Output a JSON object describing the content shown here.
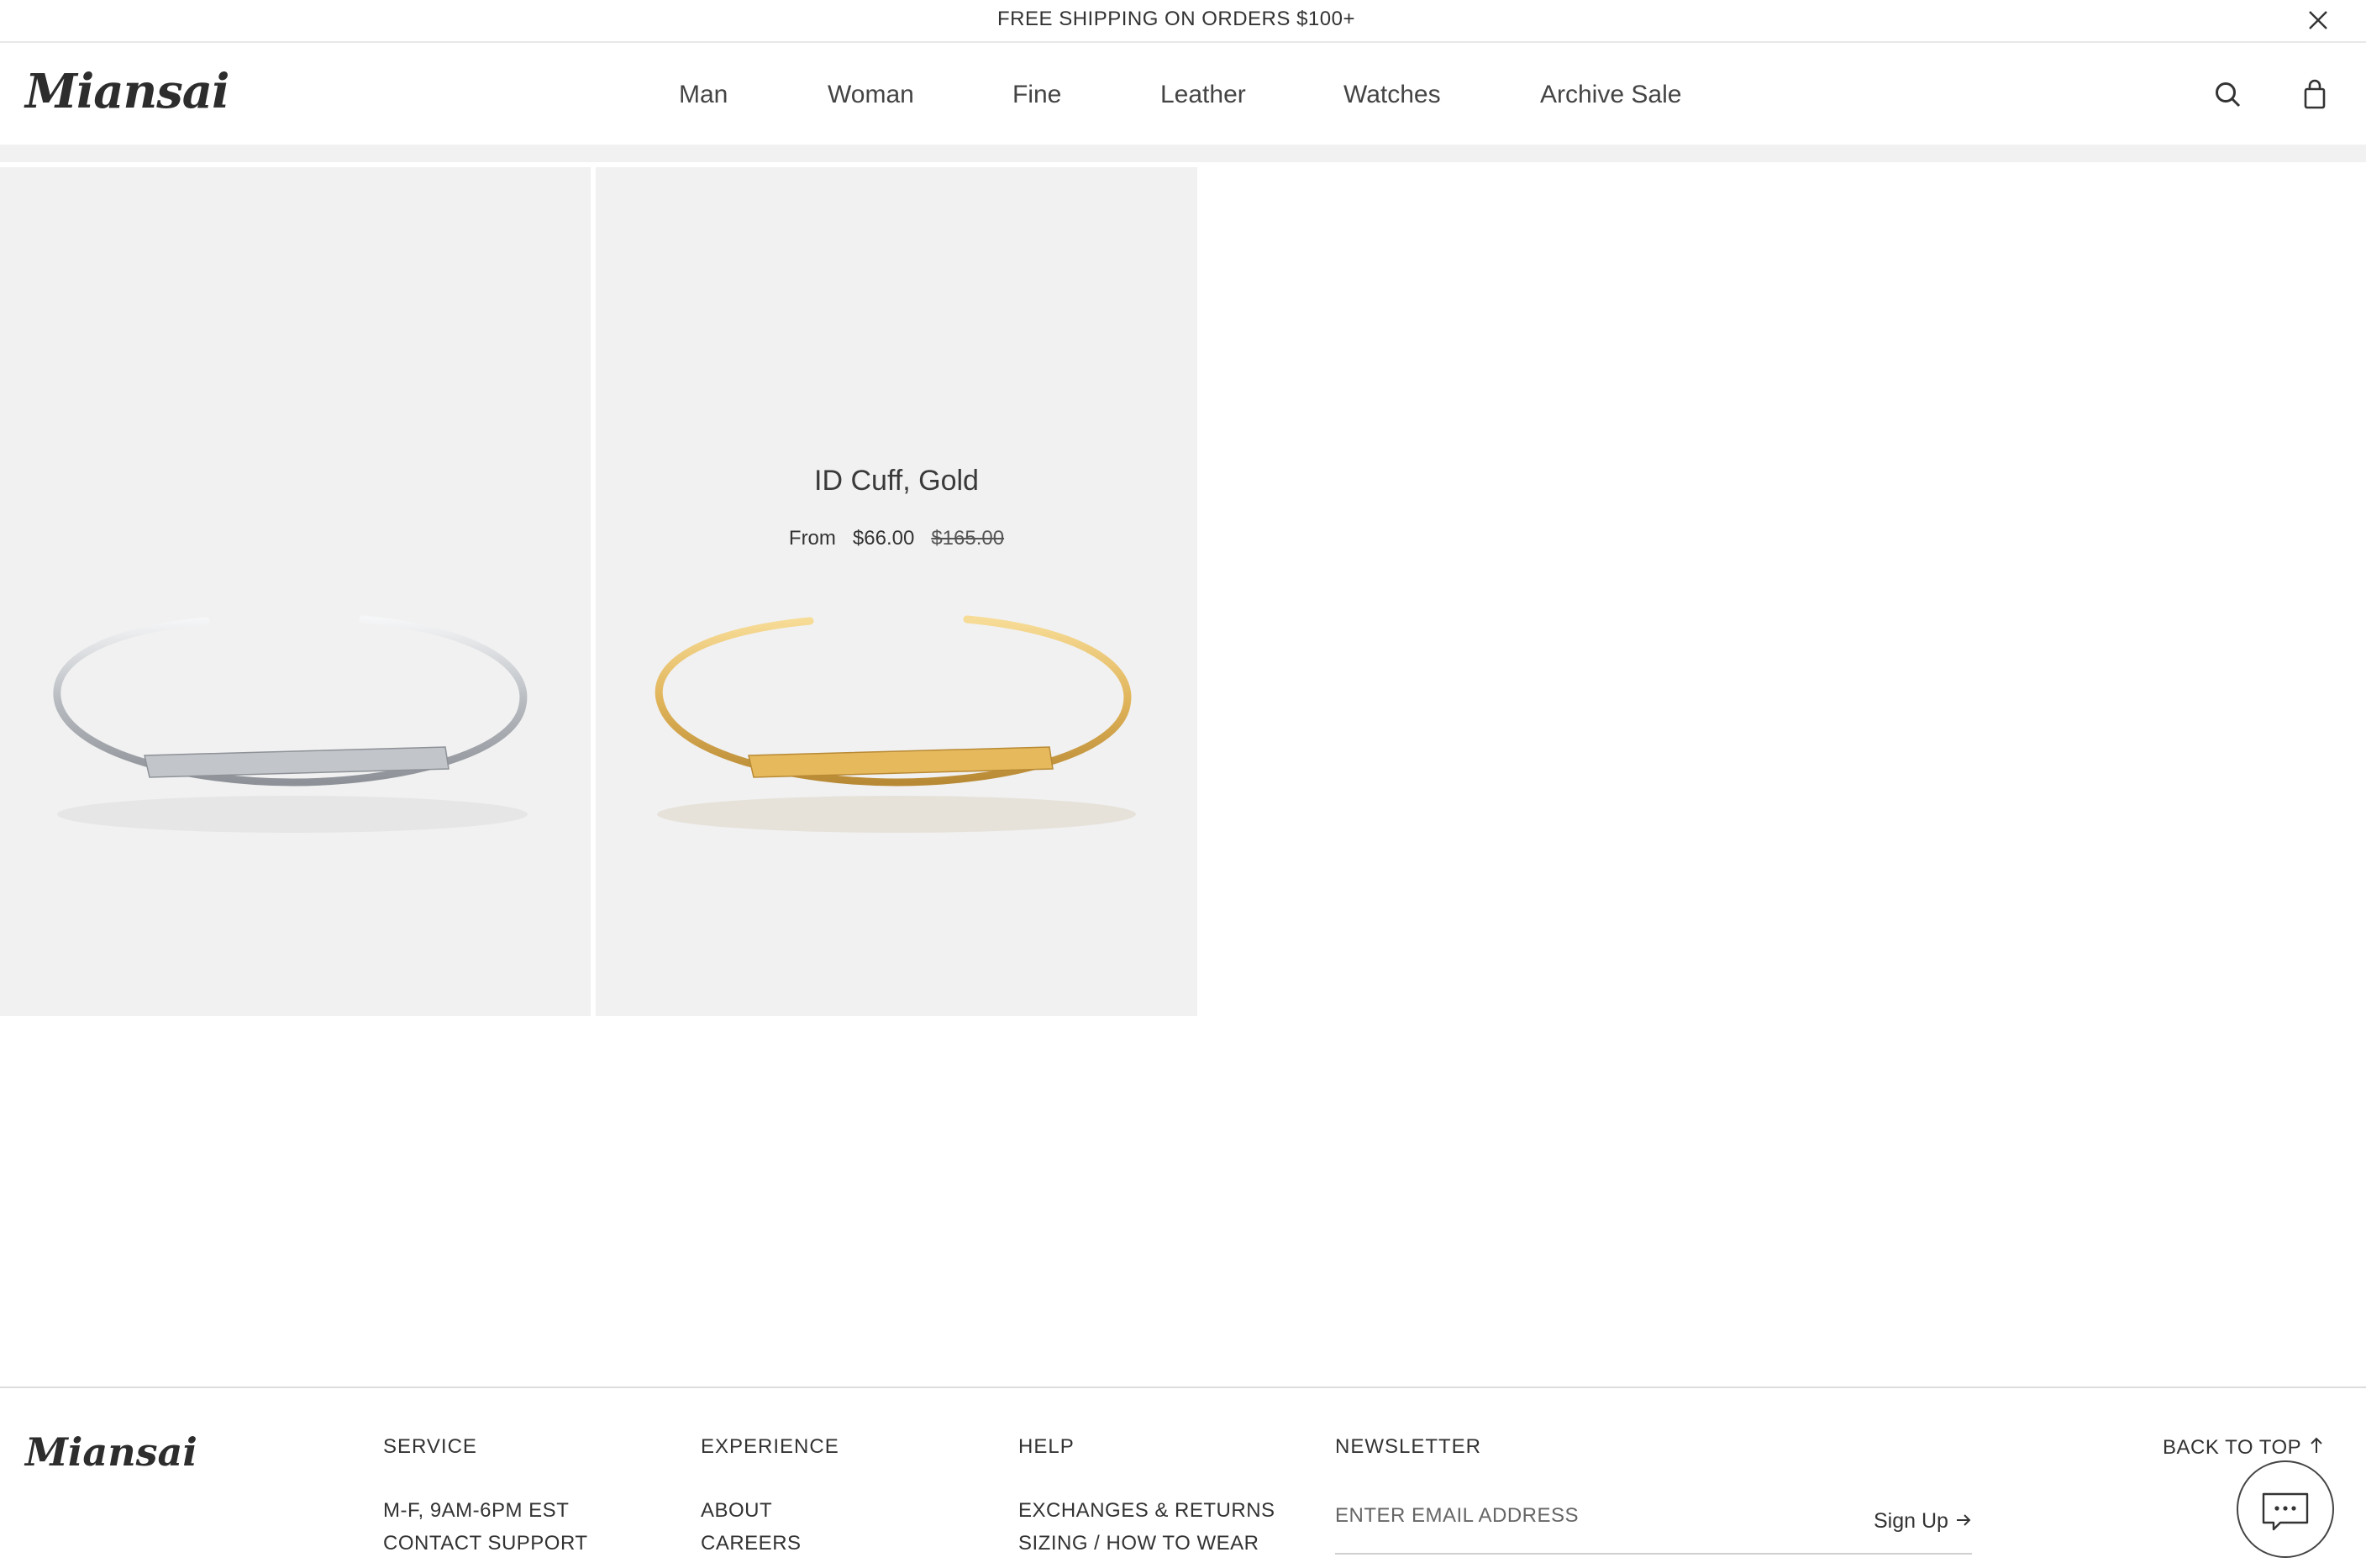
{
  "announcement": {
    "text": "FREE SHIPPING ON ORDERS $100+",
    "close_icon": "close-icon"
  },
  "header": {
    "logo": "Miansai",
    "nav": [
      {
        "label": "Man"
      },
      {
        "label": "Woman"
      },
      {
        "label": "Fine"
      },
      {
        "label": "Leather"
      },
      {
        "label": "Watches"
      },
      {
        "label": "Archive Sale"
      }
    ],
    "icons": [
      "search-icon",
      "shopping-bag-icon"
    ]
  },
  "products": [
    {
      "image": "silver-cuff-bracelet"
    },
    {
      "name": "ID Cuff, Gold",
      "price_prefix": "From",
      "price": "$66.00",
      "original_price": "$165.00",
      "image": "gold-cuff-bracelet"
    }
  ],
  "footer": {
    "logo": "Miansai",
    "columns": [
      {
        "heading": "SERVICE",
        "links": [
          "M-F, 9AM-6PM EST",
          "CONTACT SUPPORT"
        ]
      },
      {
        "heading": "EXPERIENCE",
        "links": [
          "ABOUT",
          "CAREERS"
        ]
      },
      {
        "heading": "HELP",
        "links": [
          "EXCHANGES & RETURNS",
          "SIZING / HOW TO WEAR"
        ]
      }
    ],
    "newsletter": {
      "heading": "NEWSLETTER",
      "placeholder": "ENTER EMAIL ADDRESS",
      "signup_label": "Sign Up"
    },
    "back_to_top": "BACK TO TOP",
    "chat_icon": "chat-icon"
  },
  "colors": {
    "tile_bg": "#f1f1f1",
    "text": "#2b2b2b",
    "silver": "#c9ccd0",
    "gold": "#e0b45a"
  }
}
